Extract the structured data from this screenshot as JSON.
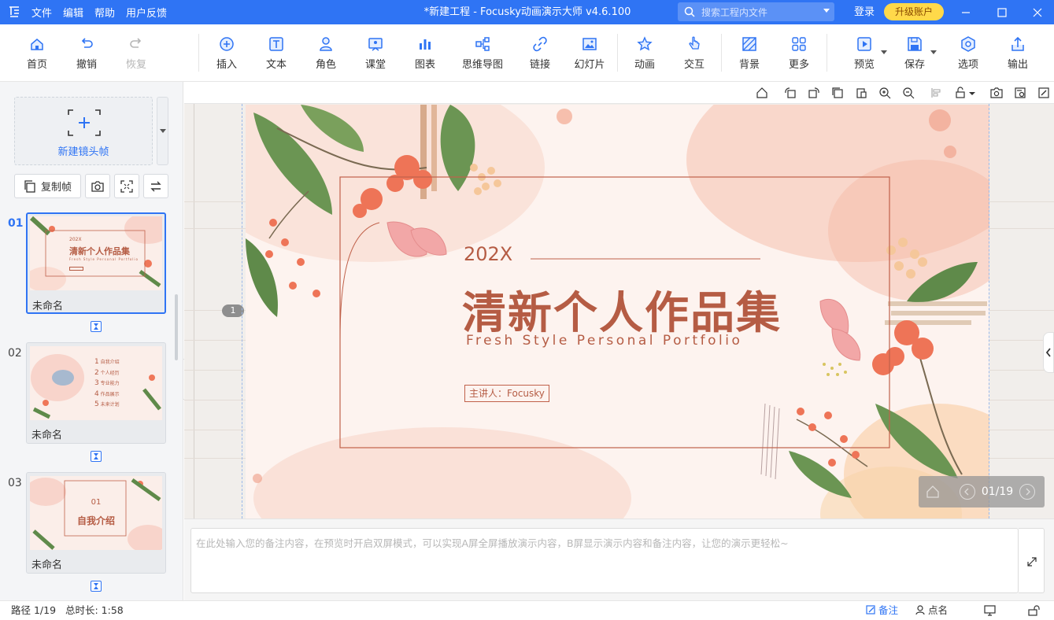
{
  "app": {
    "title": "*新建工程 - Focusky动画演示大师  v4.6.100",
    "menu": [
      "文件",
      "编辑",
      "帮助",
      "用户反馈"
    ],
    "search_placeholder": "搜索工程内文件",
    "login": "登录",
    "upgrade": "升级账户",
    "accent": "#2f74f4"
  },
  "toolbar": {
    "home": "首页",
    "undo": "撤销",
    "redo": "恢复",
    "insert": "插入",
    "text": "文本",
    "role": "角色",
    "classroom": "课堂",
    "chart": "图表",
    "mindmap": "思维导图",
    "link": "链接",
    "slide": "幻灯片",
    "animation": "动画",
    "interaction": "交互",
    "background": "背景",
    "more": "更多",
    "preview": "预览",
    "save": "保存",
    "options": "选项",
    "export": "输出"
  },
  "sidebar": {
    "new_frame": "新建镜头帧",
    "copy_frame": "复制帧",
    "frames": [
      {
        "num": "01",
        "name": "未命名",
        "active": true,
        "title": "清新个人作品集",
        "year": "202X",
        "subtitle": "Fresh Style Personal Portfolio"
      },
      {
        "num": "02",
        "name": "未命名",
        "active": false,
        "items": [
          "自我介绍",
          "个人经历",
          "专业能力",
          "作品展示",
          "未来计划"
        ],
        "nums": [
          "1",
          "2",
          "3",
          "4",
          "5"
        ]
      },
      {
        "num": "03",
        "name": "未命名",
        "active": false,
        "num_label": "01",
        "title": "自我介绍"
      }
    ]
  },
  "canvas": {
    "frame_marker": "1",
    "slide": {
      "year": "202X",
      "title": "清新个人作品集",
      "subtitle": "Fresh Style Personal Portfolio",
      "presenter": "主讲人：Focusky"
    },
    "pager": "01/19"
  },
  "notes": {
    "placeholder": "在此处输入您的备注内容，在预览时开启双屏模式，可以实现A屏全屏播放演示内容，B屏显示演示内容和备注内容，让您的演示更轻松~"
  },
  "status": {
    "path": "路径 1/19",
    "duration": "总时长: 1:58",
    "notes_tab": "备注",
    "rollcall": "点名"
  }
}
